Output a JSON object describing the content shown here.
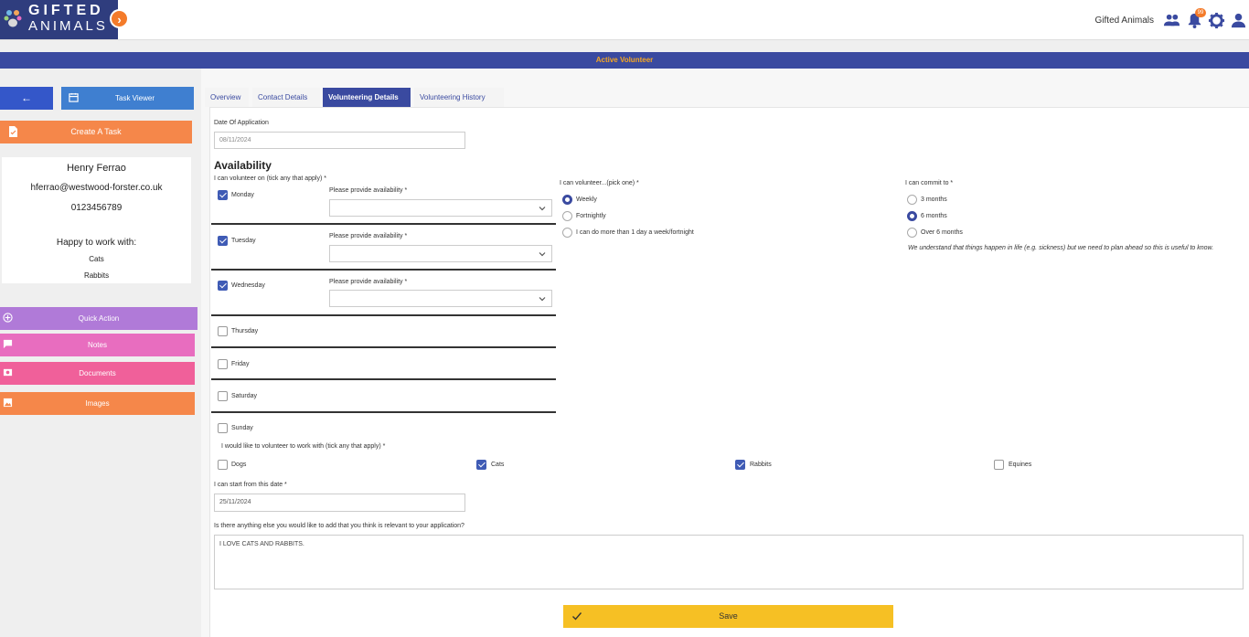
{
  "header": {
    "logo_line1": "GIFTED",
    "logo_line2": "ANIMALS",
    "org_name": "Gifted Animals",
    "notification_count": "99"
  },
  "status_bar": {
    "text": "Active Volunteer"
  },
  "sidebar": {
    "task_viewer_label": "Task Viewer",
    "create_task_label": "Create A Task",
    "contact": {
      "name": "Henry Ferrao",
      "email": "hferrao@westwood-forster.co.uk",
      "phone": "0123456789",
      "happy_label": "Happy to work with:",
      "animals": [
        "Cats",
        "Rabbits"
      ]
    },
    "actions": {
      "quick_action": "Quick Action",
      "notes": "Notes",
      "documents": "Documents",
      "images": "Images"
    }
  },
  "tabs": [
    {
      "label": "Overview",
      "active": false
    },
    {
      "label": "Contact Details",
      "active": false
    },
    {
      "label": "Volunteering Details",
      "active": true
    },
    {
      "label": "Volunteering History",
      "active": false
    }
  ],
  "form": {
    "date_of_application_label": "Date Of Application",
    "date_of_application_value": "08/11/2024",
    "availability_heading": "Availability",
    "days_label": "I can volunteer on (tick any that apply) *",
    "availability_prompt": "Please provide availability *",
    "days": [
      {
        "label": "Monday",
        "checked": true
      },
      {
        "label": "Tuesday",
        "checked": true
      },
      {
        "label": "Wednesday",
        "checked": true
      },
      {
        "label": "Thursday",
        "checked": false
      },
      {
        "label": "Friday",
        "checked": false
      },
      {
        "label": "Saturday",
        "checked": false
      },
      {
        "label": "Sunday",
        "checked": false
      }
    ],
    "frequency_label": "I can volunteer...(pick one) *",
    "frequency_options": [
      {
        "label": "Weekly",
        "selected": true
      },
      {
        "label": "Fortnightly",
        "selected": false
      },
      {
        "label": "I can do more than 1 day a week/fortnight",
        "selected": false
      }
    ],
    "commit_label": "I can commit to *",
    "commit_options": [
      {
        "label": "3 months",
        "selected": false
      },
      {
        "label": "6 months",
        "selected": true
      },
      {
        "label": "Over 6 months",
        "selected": false
      }
    ],
    "commit_note": "We understand that things happen in life (e.g. sickness) but we need to plan ahead so this is useful to know.",
    "animals_label": "I would like to volunteer to work with (tick any that apply) *",
    "animals": [
      {
        "label": "Dogs",
        "checked": false
      },
      {
        "label": "Cats",
        "checked": true
      },
      {
        "label": "Rabbits",
        "checked": true
      },
      {
        "label": "Equines",
        "checked": false
      }
    ],
    "start_date_label": "I can start from this date *",
    "start_date_value": "25/11/2024",
    "extra_label": "Is there anything else you would like to add that you think is relevant to your application?",
    "extra_value": "I LOVE CATS AND RABBITS.",
    "save_label": "Save"
  },
  "colors": {
    "primary": "#3a4aa0",
    "accent_orange": "#f5874a",
    "status_text": "#f5a623",
    "save_yellow": "#f6c024"
  }
}
